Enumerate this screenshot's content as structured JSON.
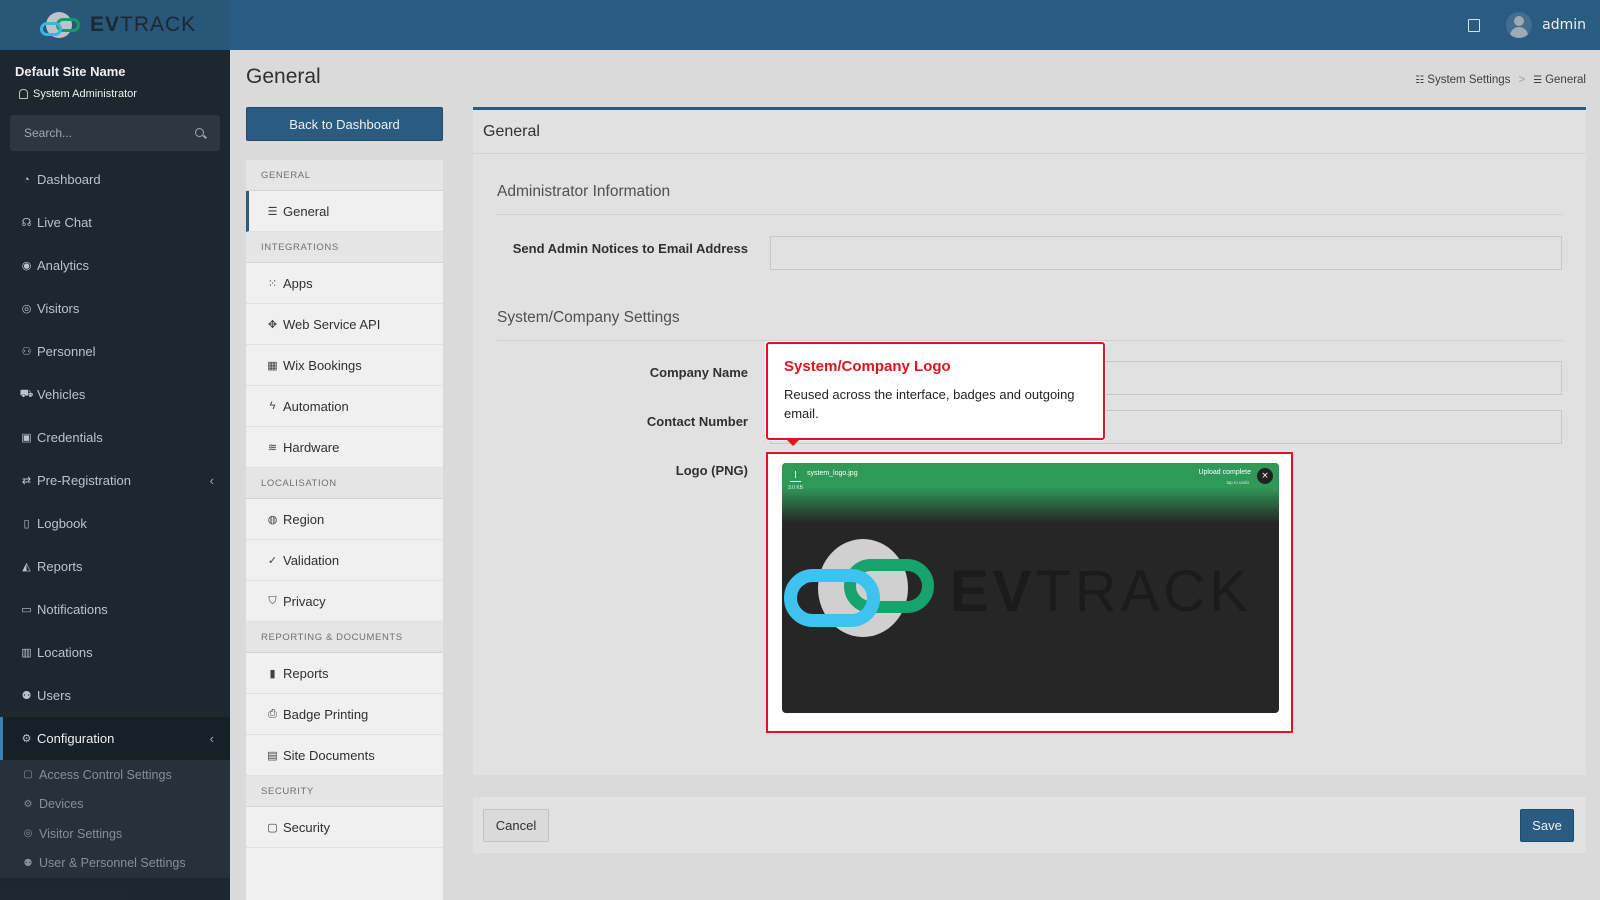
{
  "brand": {
    "part1": "EV",
    "part2": "TRACK"
  },
  "topbar": {
    "user": "admin"
  },
  "sidebar": {
    "site_name": "Default Site Name",
    "role": "System Administrator",
    "search_placeholder": "Search...",
    "items": [
      {
        "label": "Dashboard",
        "icon": "dashboard-icon",
        "glyph": "◔"
      },
      {
        "label": "Live Chat",
        "icon": "headset-icon",
        "glyph": "☊"
      },
      {
        "label": "Analytics",
        "icon": "target-icon",
        "glyph": "◉"
      },
      {
        "label": "Visitors",
        "icon": "eye-icon",
        "glyph": "◎"
      },
      {
        "label": "Personnel",
        "icon": "user-cog-icon",
        "glyph": "⚇"
      },
      {
        "label": "Vehicles",
        "icon": "car-icon",
        "glyph": "⛟"
      },
      {
        "label": "Credentials",
        "icon": "id-card-icon",
        "glyph": "▣"
      },
      {
        "label": "Pre-Registration",
        "icon": "exchange-icon",
        "glyph": "⇄"
      },
      {
        "label": "Logbook",
        "icon": "book-icon",
        "glyph": "▯"
      },
      {
        "label": "Reports",
        "icon": "chart-area-icon",
        "glyph": "◭"
      },
      {
        "label": "Notifications",
        "icon": "message-icon",
        "glyph": "▭"
      },
      {
        "label": "Locations",
        "icon": "map-icon",
        "glyph": "▥"
      },
      {
        "label": "Users",
        "icon": "users-icon",
        "glyph": "⚉"
      },
      {
        "label": "Configuration",
        "icon": "cog-icon",
        "glyph": "⚙"
      }
    ],
    "sub_items": [
      {
        "label": "Access Control Settings",
        "icon": "lock-icon",
        "glyph": "▢"
      },
      {
        "label": "Devices",
        "icon": "gear-icon",
        "glyph": "⚙"
      },
      {
        "label": "Visitor Settings",
        "icon": "eye-icon",
        "glyph": "◎"
      },
      {
        "label": "User & Personnel Settings",
        "icon": "users-icon",
        "glyph": "⚉"
      }
    ]
  },
  "page": {
    "title": "General",
    "breadcrumb": [
      "System Settings",
      "General"
    ]
  },
  "settings_menu": {
    "back_label": "Back to Dashboard",
    "groups": [
      {
        "header": "GENERAL",
        "items": [
          {
            "label": "General",
            "icon": "list-icon",
            "glyph": "☰"
          }
        ]
      },
      {
        "header": "INTEGRATIONS",
        "items": [
          {
            "label": "Apps",
            "icon": "grid-icon",
            "glyph": "⁙"
          },
          {
            "label": "Web Service API",
            "icon": "arrows-icon",
            "glyph": "✥"
          },
          {
            "label": "Wix Bookings",
            "icon": "calendar-icon",
            "glyph": "▦"
          },
          {
            "label": "Automation",
            "icon": "bolt-icon",
            "glyph": "ϟ"
          },
          {
            "label": "Hardware",
            "icon": "server-icon",
            "glyph": "≋"
          }
        ]
      },
      {
        "header": "LOCALISATION",
        "items": [
          {
            "label": "Region",
            "icon": "globe-icon",
            "glyph": "◍"
          },
          {
            "label": "Validation",
            "icon": "check-circle-icon",
            "glyph": "✓"
          },
          {
            "label": "Privacy",
            "icon": "shield-icon",
            "glyph": "⛉"
          }
        ]
      },
      {
        "header": "REPORTING & DOCUMENTS",
        "items": [
          {
            "label": "Reports",
            "icon": "bar-chart-icon",
            "glyph": "▮"
          },
          {
            "label": "Badge Printing",
            "icon": "print-icon",
            "glyph": "⎙"
          },
          {
            "label": "Site Documents",
            "icon": "file-icon",
            "glyph": "▤"
          }
        ]
      },
      {
        "header": "SECURITY",
        "items": [
          {
            "label": "Security",
            "icon": "lock-icon",
            "glyph": "▢"
          }
        ]
      }
    ]
  },
  "panel": {
    "title": "General",
    "admin_section": "Administrator Information",
    "admin_email_label": "Send Admin Notices to Email Address",
    "admin_email_value": "",
    "company_section": "System/Company Settings",
    "company_name_label": "Company Name",
    "contact_number_label": "Contact Number",
    "logo_label": "Logo (PNG)"
  },
  "upload": {
    "file_name": "system_logo.jpg",
    "file_size": "3.0 KB",
    "status": "Upload complete",
    "undo": "tap to undo"
  },
  "tooltip": {
    "title": "System/Company Logo",
    "body": "Reused across the interface, badges and outgoing email."
  },
  "footer": {
    "cancel_label": "Cancel",
    "save_label": "Save"
  },
  "colors": {
    "brand_blue": "#2d6188",
    "highlight_red": "#e0141e",
    "sidebar_bg": "#1f2a33"
  }
}
